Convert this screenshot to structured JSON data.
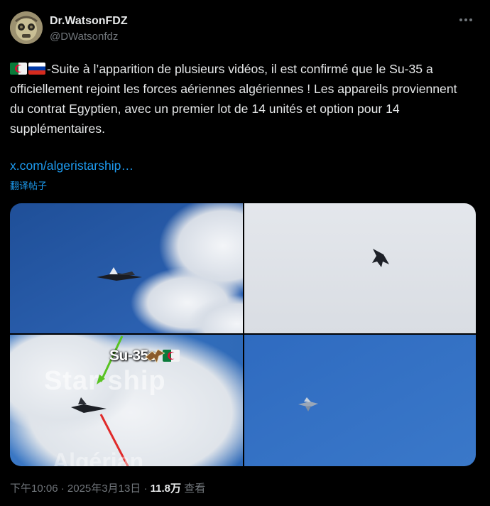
{
  "author": {
    "display_name": "Dr.WatsonFDZ",
    "handle": "@DWatsonfdz",
    "avatar_icon": "masked-character-avatar"
  },
  "tweet": {
    "flags": [
      "algeria-flag-icon",
      "russia-flag-icon"
    ],
    "text": "-Suite à l’apparition de plusieurs vidéos, il est confirmé que le Su-35 a officiellement rejoint les forces aériennes algériennes ! Les appareils proviennent du contrat Egyptien, avec un premier lot de 14 unités et option pour 14 supplémentaires.",
    "link": "x.com/algeristarship…",
    "translate_label": "翻译帖子"
  },
  "media": {
    "overlay_label": "Su-35s",
    "watermark_1": "Star ship",
    "watermark_2": "Algérian",
    "overlay_icons": [
      "algeria-flag-icon",
      "eagle-icon",
      "green-arrow-icon",
      "red-line-icon"
    ]
  },
  "meta": {
    "time": "下午10:06",
    "separator": "·",
    "date": "2025年3月13日",
    "views_count": "11.8万",
    "views_label": "查看"
  },
  "colors": {
    "background": "#000000",
    "text": "#e7e9ea",
    "secondary": "#71767b",
    "link": "#1d9bf0"
  }
}
